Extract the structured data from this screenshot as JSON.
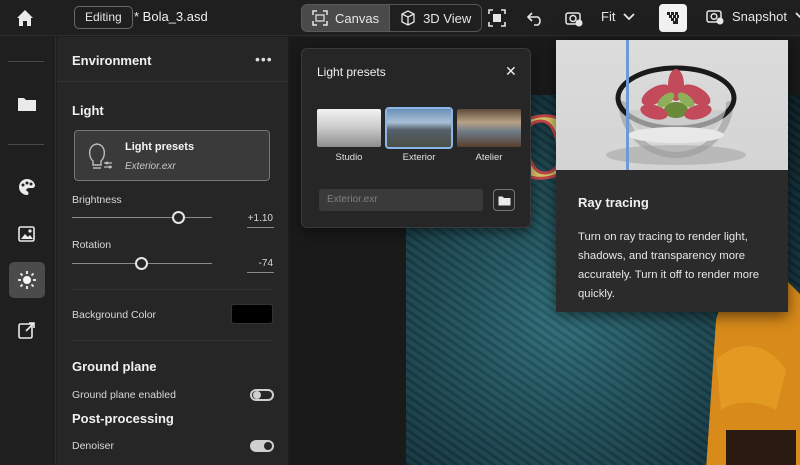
{
  "topbar": {
    "status_label": "Editing",
    "doc_title": "* Bola_3.asd",
    "tab_canvas": "Canvas",
    "tab_3dview": "3D View",
    "zoom_label": "Fit",
    "snapshot_label": "Snapshot"
  },
  "panel": {
    "title": "Environment",
    "light_section": "Light",
    "light_card_title": "Light presets",
    "light_card_file": "Exterior.exr",
    "brightness_label": "Brightness",
    "brightness_value": "+1.10",
    "brightness_fraction": 0.76,
    "rotation_label": "Rotation",
    "rotation_value": "-74",
    "rotation_fraction": 0.49,
    "bg_label": "Background Color",
    "bg_color": "#000000",
    "ground_section": "Ground plane",
    "ground_enabled_label": "Ground plane enabled",
    "ground_enabled": false,
    "post_section": "Post-processing",
    "denoiser_label": "Denoiser",
    "denoiser": true
  },
  "popover": {
    "title": "Light presets",
    "presets": [
      {
        "label": "Studio",
        "selected": false
      },
      {
        "label": "Exterior",
        "selected": true
      },
      {
        "label": "Atelier",
        "selected": false
      }
    ],
    "file_placeholder": "Exterior.exr"
  },
  "tooltip": {
    "title": "Ray tracing",
    "body": "Turn on ray tracing to render light, shadows, and transparency more accurately. Turn it off to render more quickly."
  },
  "colors": {
    "accent_selection": "#8ab6e8",
    "panel_bg": "#262626",
    "app_bg": "#1e1e1e"
  }
}
